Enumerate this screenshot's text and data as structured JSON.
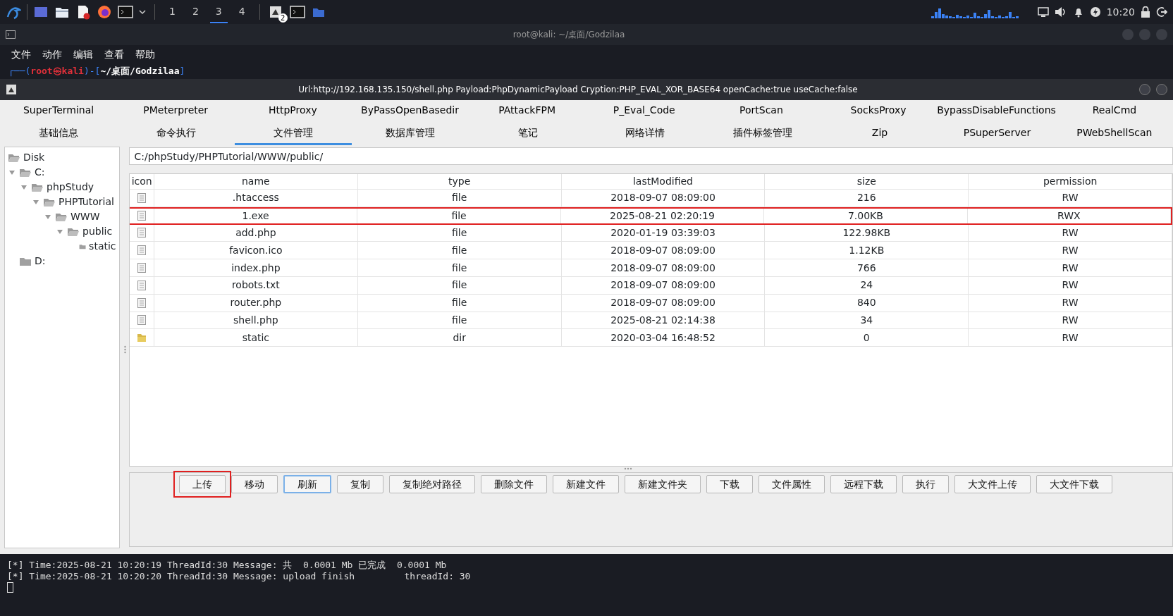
{
  "taskbar": {
    "launchers": [
      {
        "kind": "kali"
      },
      {
        "kind": "desktop"
      },
      {
        "kind": "files"
      },
      {
        "kind": "document"
      },
      {
        "kind": "browser"
      },
      {
        "kind": "terminal"
      }
    ],
    "workspaces": [
      {
        "label": "1",
        "selected": false
      },
      {
        "label": "2",
        "selected": false
      },
      {
        "label": "3",
        "selected": true
      },
      {
        "label": "4",
        "selected": false
      }
    ],
    "tasks": [
      {
        "kind": "app",
        "badge": "2"
      },
      {
        "kind": "terminal"
      },
      {
        "kind": "folder"
      }
    ],
    "clock": "10:20"
  },
  "terminal": {
    "title": "root@kali: ~/桌面/Godzilaa",
    "menu": [
      "文件",
      "动作",
      "编辑",
      "查看",
      "帮助"
    ],
    "prompt": [
      {
        "kind": "frame",
        "text": "┌──("
      },
      {
        "kind": "user",
        "text": "root㉿kali"
      },
      {
        "kind": "frame",
        "text": ")-["
      },
      {
        "kind": "path",
        "text": "~/桌面/Godzilaa"
      },
      {
        "kind": "frame",
        "text": "]"
      }
    ],
    "log": [
      "[*] Time:2025-08-21 10:20:19 ThreadId:30 Message: 共  0.0001 Mb 已完成  0.0001 Mb",
      "[*] Time:2025-08-21 10:20:20 ThreadId:30 Message: upload finish         threadId: 30"
    ]
  },
  "window": {
    "title": "Url:http://192.168.135.150/shell.php Payload:PhpDynamicPayload Cryption:PHP_EVAL_XOR_BASE64 openCache:true useCache:false"
  },
  "plugin_tabs": [
    {
      "label": "SuperTerminal",
      "selected": false
    },
    {
      "label": "PMeterpreter",
      "selected": false
    },
    {
      "label": "HttpProxy",
      "selected": false
    },
    {
      "label": "ByPassOpenBasedir",
      "selected": false
    },
    {
      "label": "PAttackFPM",
      "selected": false
    },
    {
      "label": "P_Eval_Code",
      "selected": false
    },
    {
      "label": "PortScan",
      "selected": false
    },
    {
      "label": "SocksProxy",
      "selected": false
    },
    {
      "label": "BypassDisableFunctions",
      "selected": false
    },
    {
      "label": "RealCmd",
      "selected": false
    }
  ],
  "tabs": [
    {
      "label": "基础信息",
      "selected": false
    },
    {
      "label": "命令执行",
      "selected": false
    },
    {
      "label": "文件管理",
      "selected": true
    },
    {
      "label": "数据库管理",
      "selected": false
    },
    {
      "label": "笔记",
      "selected": false
    },
    {
      "label": "网络详情",
      "selected": false
    },
    {
      "label": "插件标签管理",
      "selected": false
    },
    {
      "label": "Zip",
      "selected": false
    },
    {
      "label": "PSuperServer",
      "selected": false
    },
    {
      "label": "PWebShellScan",
      "selected": false
    }
  ],
  "tree": {
    "root": "Disk",
    "children": [
      {
        "label": "C:",
        "expanded": true,
        "children": [
          {
            "label": "phpStudy",
            "expanded": true,
            "children": [
              {
                "label": "PHPTutorial",
                "expanded": true,
                "children": [
                  {
                    "label": "WWW",
                    "expanded": true,
                    "children": [
                      {
                        "label": "public",
                        "expanded": true,
                        "children": [
                          {
                            "label": "static"
                          }
                        ]
                      }
                    ]
                  }
                ]
              }
            ]
          }
        ]
      },
      {
        "label": "D:"
      }
    ]
  },
  "path": "C:/phpStudy/PHPTutorial/WWW/public/",
  "table": {
    "columns": [
      "icon",
      "name",
      "type",
      "lastModified",
      "size",
      "permission"
    ],
    "rows": [
      {
        "kind": "file",
        "name": ".htaccess",
        "type": "file",
        "lastModified": "2018-09-07 08:09:00",
        "size": "216",
        "permission": "RW",
        "highlighted": false
      },
      {
        "kind": "file",
        "name": "1.exe",
        "type": "file",
        "lastModified": "2025-08-21 02:20:19",
        "size": "7.00KB",
        "permission": "RWX",
        "highlighted": true
      },
      {
        "kind": "file",
        "name": "add.php",
        "type": "file",
        "lastModified": "2020-01-19 03:39:03",
        "size": "122.98KB",
        "permission": "RW",
        "highlighted": false
      },
      {
        "kind": "file",
        "name": "favicon.ico",
        "type": "file",
        "lastModified": "2018-09-07 08:09:00",
        "size": "1.12KB",
        "permission": "RW",
        "highlighted": false
      },
      {
        "kind": "file",
        "name": "index.php",
        "type": "file",
        "lastModified": "2018-09-07 08:09:00",
        "size": "766",
        "permission": "RW",
        "highlighted": false
      },
      {
        "kind": "file",
        "name": "robots.txt",
        "type": "file",
        "lastModified": "2018-09-07 08:09:00",
        "size": "24",
        "permission": "RW",
        "highlighted": false
      },
      {
        "kind": "file",
        "name": "router.php",
        "type": "file",
        "lastModified": "2018-09-07 08:09:00",
        "size": "840",
        "permission": "RW",
        "highlighted": false
      },
      {
        "kind": "file",
        "name": "shell.php",
        "type": "file",
        "lastModified": "2025-08-21 02:14:38",
        "size": "34",
        "permission": "RW",
        "highlighted": false
      },
      {
        "kind": "dir",
        "name": "static",
        "type": "dir",
        "lastModified": "2020-03-04 16:48:52",
        "size": "0",
        "permission": "RW",
        "highlighted": false
      }
    ]
  },
  "buttons": [
    {
      "label": "上传",
      "highlighted": true,
      "focused": false
    },
    {
      "label": "移动",
      "highlighted": false,
      "focused": false
    },
    {
      "label": "刷新",
      "highlighted": false,
      "focused": true
    },
    {
      "label": "复制",
      "highlighted": false,
      "focused": false
    },
    {
      "label": "复制绝对路径",
      "highlighted": false,
      "focused": false
    },
    {
      "label": "删除文件",
      "highlighted": false,
      "focused": false
    },
    {
      "label": "新建文件",
      "highlighted": false,
      "focused": false
    },
    {
      "label": "新建文件夹",
      "highlighted": false,
      "focused": false
    },
    {
      "label": "下载",
      "highlighted": false,
      "focused": false
    },
    {
      "label": "文件属性",
      "highlighted": false,
      "focused": false
    },
    {
      "label": "远程下载",
      "highlighted": false,
      "focused": false
    },
    {
      "label": "执行",
      "highlighted": false,
      "focused": false
    },
    {
      "label": "大文件上传",
      "highlighted": false,
      "focused": false
    },
    {
      "label": "大文件下载",
      "highlighted": false,
      "focused": false
    }
  ]
}
